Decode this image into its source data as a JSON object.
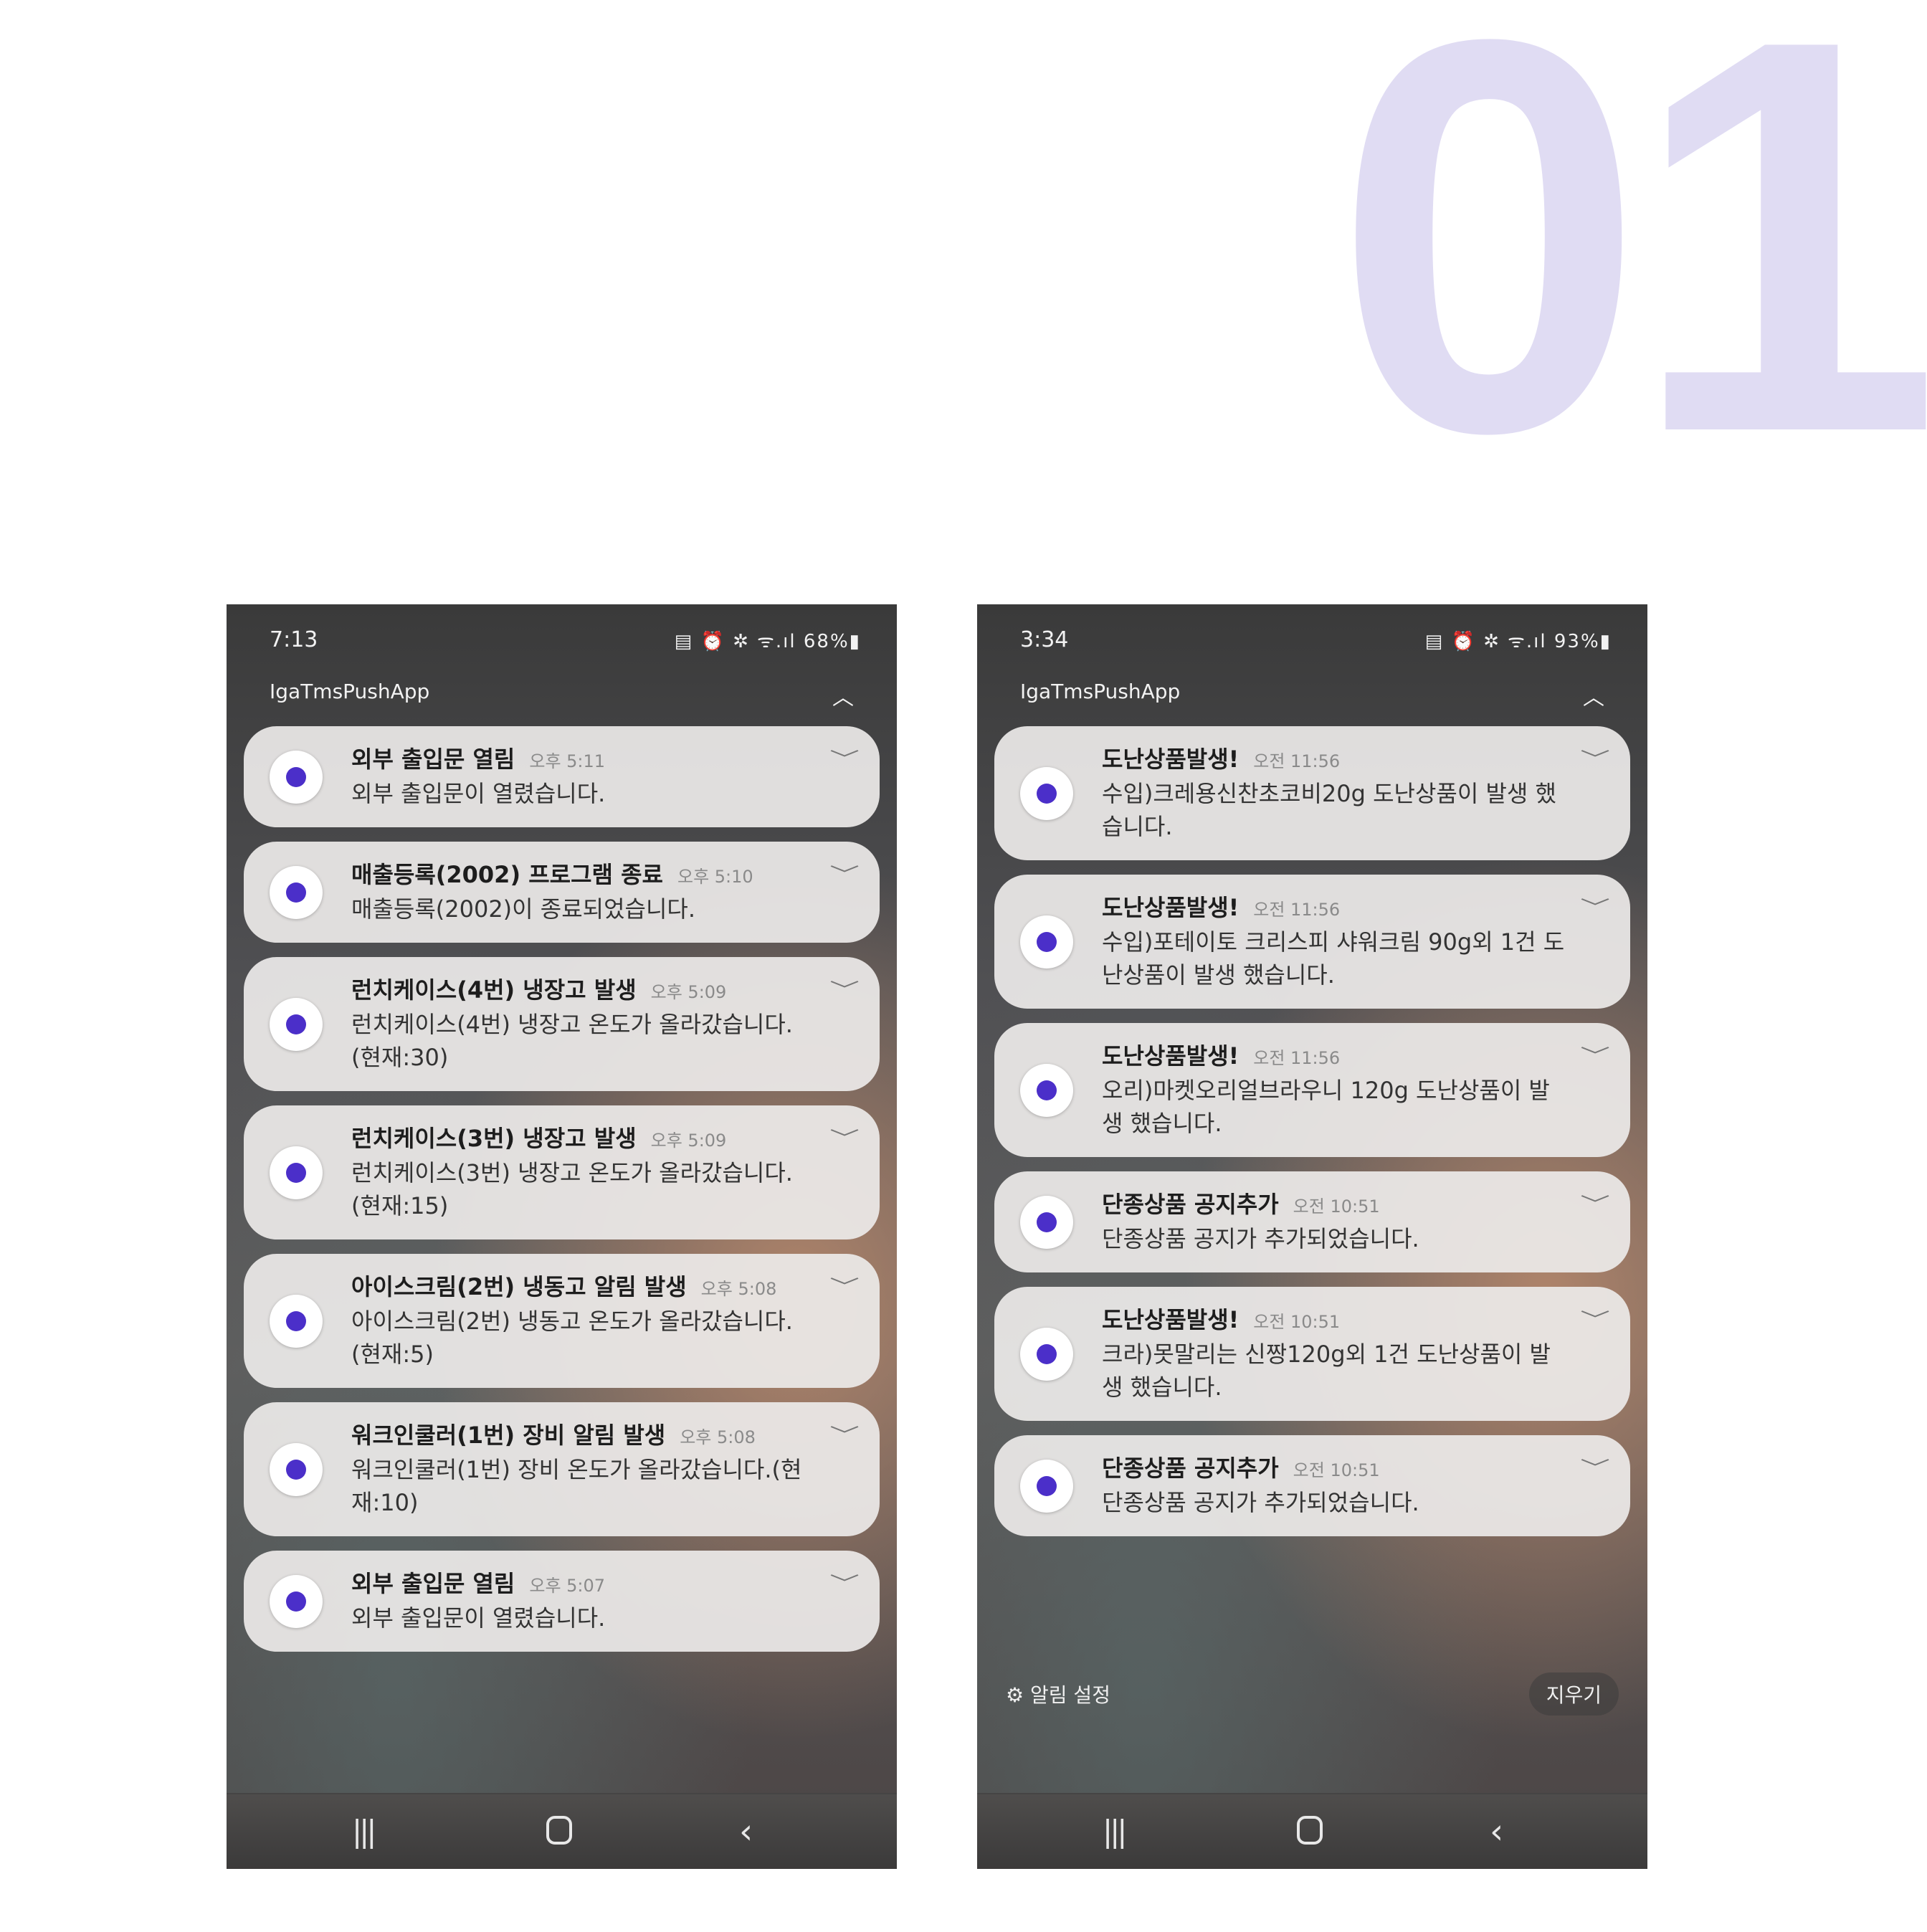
{
  "page": {
    "big_number": "01"
  },
  "left_phone": {
    "status_time": "7:13",
    "status_icons": "▤ ⏰ ✲ ᯤ.ıl 68%▮",
    "app_name": "IgaTmsPushApp",
    "notifications": [
      {
        "title": "외부 출입문 열림",
        "time": "오후 5:11",
        "body": "외부 출입문이 열렸습니다."
      },
      {
        "title": "매출등록(2002) 프로그램 종료",
        "time": "오후 5:10",
        "body": "매출등록(2002)이 종료되었습니다."
      },
      {
        "title": "런치케이스(4번) 냉장고 발생",
        "time": "오후 5:09",
        "body": "런치케이스(4번) 냉장고 온도가 올라갔습니다.(현재:30)"
      },
      {
        "title": "런치케이스(3번) 냉장고 발생",
        "time": "오후 5:09",
        "body": "런치케이스(3번) 냉장고 온도가 올라갔습니다.(현재:15)"
      },
      {
        "title": "아이스크림(2번) 냉동고 알림 발생",
        "time": "오후 5:08",
        "body": "아이스크림(2번) 냉동고 온도가 올라갔습니다.(현재:5)"
      },
      {
        "title": "워크인쿨러(1번) 장비 알림 발생",
        "time": "오후 5:08",
        "body": "워크인쿨러(1번) 장비 온도가 올라갔습니다.(현재:10)"
      },
      {
        "title": "외부 출입문 열림",
        "time": "오후 5:07",
        "body": "외부 출입문이 열렸습니다."
      }
    ]
  },
  "right_phone": {
    "status_time": "3:34",
    "status_icons": "▤ ⏰ ✲ ᯤ.ıl 93%▮",
    "app_name": "IgaTmsPushApp",
    "notifications": [
      {
        "title": "도난상품발생!",
        "time": "오전 11:56",
        "body": "수입)크레용신찬초코비20g 도난상품이 발생 했습니다."
      },
      {
        "title": "도난상품발생!",
        "time": "오전 11:56",
        "body": "수입)포테이토 크리스피 샤워크림 90g외 1건 도난상품이 발생 했습니다."
      },
      {
        "title": "도난상품발생!",
        "time": "오전 11:56",
        "body": "오리)마켓오리얼브라우니 120g 도난상품이 발생 했습니다."
      },
      {
        "title": "단종상품 공지추가",
        "time": "오전 10:51",
        "body": "단종상품 공지가 추가되었습니다."
      },
      {
        "title": "도난상품발생!",
        "time": "오전 10:51",
        "body": "크라)못말리는 신짱120g외 1건 도난상품이 발생 했습니다."
      },
      {
        "title": "단종상품 공지추가",
        "time": "오전 10:51",
        "body": "단종상품 공지가 추가되었습니다."
      }
    ],
    "settings_label": "알림 설정",
    "clear_label": "지우기"
  },
  "icons": {
    "collapse": "chevron-up-icon",
    "expand": "chevron-down-icon",
    "settings": "gear-icon",
    "nav_recent": "recent-apps-icon",
    "nav_home": "home-icon",
    "nav_back": "back-icon"
  },
  "colors": {
    "big_number": "#e0dcf3",
    "app_icon_accent": "#4b2fc9"
  }
}
